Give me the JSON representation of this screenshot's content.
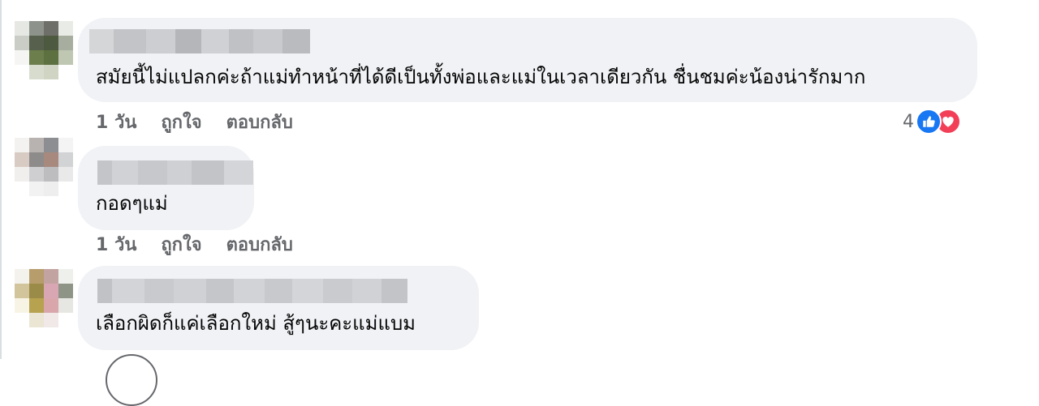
{
  "comments": [
    {
      "text": "สมัยนี้ไม่แปลกค่ะถ้าแม่ทำหน้าที่ได้ดีเป็นทั้งพ่อและแม่ในเวลาเดียวกัน ชื่นชมค่ะน้องน่ารักมาก",
      "time": "1 วัน",
      "like_label": "ถูกใจ",
      "reply_label": "ตอบกลับ",
      "reaction_count": "4",
      "reaction_icons": [
        "like-icon",
        "love-icon"
      ]
    },
    {
      "text": "กอดๆแม่",
      "time": "1 วัน",
      "like_label": "ถูกใจ",
      "reply_label": "ตอบกลับ"
    },
    {
      "text": "เลือกผิดก็แค่เลือกใหม่ สู้ๆนะคะแม่แบม"
    }
  ],
  "colors": {
    "bubble": "#f0f2f5",
    "meta_text": "#65676b",
    "like_blue": "#1877f2",
    "love_red": "#f33e58"
  }
}
